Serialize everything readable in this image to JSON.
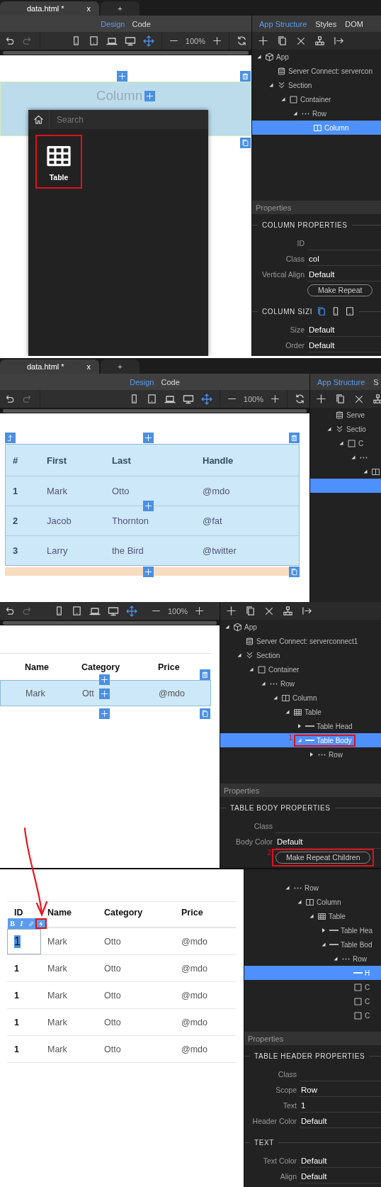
{
  "panels": [
    {
      "kind": "insert",
      "tabs": [
        {
          "label": "data.html *",
          "close": "x",
          "selected": true
        },
        {
          "label": "+",
          "selected": false
        }
      ],
      "modes": [
        {
          "label": "Design",
          "selected": true
        },
        {
          "label": "Code",
          "selected": false
        }
      ],
      "zoom": "100%",
      "canvas": {
        "block_label": "Column",
        "popup": {
          "placeholder": "Search",
          "items": [
            {
              "label": "Table",
              "highlighted": true
            }
          ]
        }
      },
      "side": {
        "tabs": [
          {
            "label": "App Structure",
            "selected": true
          },
          {
            "label": "Styles",
            "selected": false
          },
          {
            "label": "DOM",
            "selected": false
          }
        ],
        "tree": [
          {
            "kind": "app",
            "label": "App",
            "expanded": true,
            "selected": false,
            "children": [
              {
                "kind": "server",
                "label": "Server Connect: servercon",
                "selected": false
              },
              {
                "kind": "section",
                "label": "Section",
                "expanded": true,
                "selected": false,
                "children": [
                  {
                    "kind": "container",
                    "label": "Container",
                    "expanded": true,
                    "selected": false,
                    "children": [
                      {
                        "kind": "row",
                        "label": "Row",
                        "expanded": true,
                        "selected": false,
                        "children": [
                          {
                            "kind": "column",
                            "label": "Column",
                            "selected": true
                          }
                        ]
                      }
                    ]
                  }
                ]
              }
            ]
          }
        ],
        "properties": {
          "header": "Properties",
          "sections": [
            {
              "title": "COLUMN PROPERTIES",
              "fields": [
                {
                  "kind": "field",
                  "label": "ID"
                },
                {
                  "kind": "field",
                  "label": "Class",
                  "value": "col"
                },
                {
                  "kind": "field",
                  "label": "Vertical Align",
                  "value": "Default"
                },
                {
                  "kind": "button",
                  "label": "Make Repeat"
                }
              ]
            },
            {
              "title": "COLUMN SIZI",
              "devices": [
                {
                  "selected": true
                },
                {
                  "selected": false
                },
                {
                  "selected": false
                }
              ],
              "fields": [
                {
                  "kind": "field",
                  "label": "Size",
                  "value": "Default"
                },
                {
                  "kind": "field",
                  "label": "Order",
                  "value": "Default"
                }
              ]
            }
          ]
        }
      }
    },
    {
      "kind": "table",
      "tabs": [
        {
          "label": "data.html *",
          "close": "x",
          "selected": true
        },
        {
          "label": "+",
          "selected": false
        }
      ],
      "modes": [
        {
          "label": "Design",
          "selected": true
        },
        {
          "label": "Code",
          "selected": false
        }
      ],
      "zoom": "100%",
      "canvas": {
        "table": {
          "columns": [
            "#",
            "First",
            "Last",
            "Handle"
          ],
          "rows": [
            {
              "cells": [
                "1",
                "Mark",
                "Otto",
                "@mdo"
              ]
            },
            {
              "cells": [
                "2",
                "Jacob",
                "Thornton",
                "@fat"
              ]
            },
            {
              "cells": [
                "3",
                "Larry",
                "the Bird",
                "@twitter"
              ]
            }
          ]
        }
      },
      "side": {
        "tabs": [
          {
            "label": "App Structure",
            "selected": true
          },
          {
            "label": "S",
            "selected": false
          }
        ],
        "tree": [
          {
            "kind": "server",
            "label": "Serve",
            "selected": false
          },
          {
            "kind": "section",
            "label": "Sectio",
            "expanded": true,
            "selected": false,
            "children": [
              {
                "kind": "container",
                "label": "C",
                "expanded": true,
                "selected": false,
                "children": [
                  {
                    "kind": "row",
                    "expanded": true,
                    "selected": false,
                    "children": [
                      {
                        "kind": "column",
                        "expanded": true,
                        "selected": false,
                        "children": [
                          {
                            "kind": "table",
                            "selected": true
                          }
                        ]
                      }
                    ]
                  }
                ]
              }
            ]
          }
        ]
      }
    },
    {
      "kind": "repeat",
      "zoom": "100%",
      "canvas": {
        "table": {
          "columns": [
            "Name",
            "Category",
            "Price"
          ],
          "rows": [
            {
              "cells": [
                "Mark",
                "Ott",
                "@mdo"
              ]
            }
          ]
        }
      },
      "side": {
        "tree": [
          {
            "kind": "app",
            "label": "App",
            "expanded": true,
            "selected": false,
            "children": [
              {
                "kind": "server",
                "label": "Server Connect: serverconnect1",
                "selected": false
              },
              {
                "kind": "section",
                "label": "Section",
                "expanded": true,
                "selected": false,
                "children": [
                  {
                    "kind": "container",
                    "label": "Container",
                    "expanded": true,
                    "selected": false,
                    "children": [
                      {
                        "kind": "row",
                        "label": "Row",
                        "expanded": true,
                        "selected": false,
                        "children": [
                          {
                            "kind": "column",
                            "label": "Column",
                            "expanded": true,
                            "selected": false,
                            "children": [
                              {
                                "kind": "table",
                                "label": "Table",
                                "expanded": true,
                                "selected": false,
                                "children": [
                                  {
                                    "kind": "part",
                                    "label": "Table Head",
                                    "expanded": false,
                                    "selected": false
                                  },
                                  {
                                    "kind": "part",
                                    "label": "Table Body",
                                    "expanded": true,
                                    "selected": true,
                                    "highlighted": true,
                                    "marker": "1",
                                    "children": [
                                      {
                                        "kind": "row",
                                        "label": "Row",
                                        "expanded": false,
                                        "selected": false
                                      }
                                    ]
                                  }
                                ]
                              }
                            ]
                          }
                        ]
                      }
                    ]
                  }
                ]
              }
            ]
          }
        ],
        "properties": {
          "header": "Properties",
          "sections": [
            {
              "title": "TABLE BODY PROPERTIES",
              "fields": [
                {
                  "kind": "field",
                  "label": "Class"
                },
                {
                  "kind": "field",
                  "label": "Body Color",
                  "value": "Default"
                },
                {
                  "kind": "button",
                  "label": "Make Repeat Children",
                  "highlighted": true,
                  "marker": "2"
                }
              ]
            }
          ]
        }
      }
    },
    {
      "kind": "header",
      "canvas": {
        "table": {
          "columns": [
            "ID",
            "Name",
            "Category",
            "Price"
          ],
          "rows": [
            {
              "cells": [
                "1",
                "Mark",
                "Otto",
                "@mdo"
              ],
              "editing": true
            },
            {
              "cells": [
                "1",
                "Mark",
                "Otto",
                "@mdo"
              ],
              "editing": false
            },
            {
              "cells": [
                "1",
                "Mark",
                "Otto",
                "@mdo"
              ],
              "editing": false
            },
            {
              "cells": [
                "1",
                "Mark",
                "Otto",
                "@mdo"
              ],
              "editing": false
            },
            {
              "cells": [
                "1",
                "Mark",
                "Otto",
                "@mdo"
              ],
              "editing": false
            }
          ]
        },
        "format_tools": [
          {
            "kind": "text",
            "label": "B"
          },
          {
            "kind": "text",
            "label": "I"
          },
          {
            "kind": "link"
          },
          {
            "kind": "bolt",
            "highlighted": true
          }
        ]
      },
      "side": {
        "tree": [
          {
            "kind": "row",
            "label": "Row",
            "expanded": true,
            "selected": false,
            "children": [
              {
                "kind": "column",
                "label": "Column",
                "expanded": true,
                "selected": false,
                "children": [
                  {
                    "kind": "table",
                    "label": "Table",
                    "expanded": true,
                    "selected": false,
                    "children": [
                      {
                        "kind": "part",
                        "label": "Table Hea",
                        "expanded": false,
                        "selected": false
                      },
                      {
                        "kind": "part",
                        "label": "Table Bod",
                        "expanded": true,
                        "selected": false,
                        "children": [
                          {
                            "kind": "row",
                            "label": "Row",
                            "expanded": true,
                            "selected": false,
                            "children": [
                              {
                                "kind": "part",
                                "label": "H",
                                "selected": true
                              },
                              {
                                "kind": "cell",
                                "label": "C",
                                "selected": false
                              },
                              {
                                "kind": "cell",
                                "label": "C",
                                "selected": false
                              },
                              {
                                "kind": "cell",
                                "label": "C",
                                "selected": false
                              }
                            ]
                          }
                        ]
                      }
                    ]
                  }
                ]
              }
            ]
          }
        ],
        "properties": {
          "header": "Properties",
          "sections": [
            {
              "title": "TABLE HEADER PROPERTIES",
              "fields": [
                {
                  "kind": "field",
                  "label": "Class"
                },
                {
                  "kind": "field",
                  "label": "Scope",
                  "value": "Row"
                },
                {
                  "kind": "field",
                  "label": "Text",
                  "value": "1"
                },
                {
                  "kind": "field",
                  "label": "Header Color",
                  "value": "Default"
                }
              ]
            },
            {
              "title": "TEXT",
              "fields": [
                {
                  "kind": "field",
                  "label": "Text Color",
                  "value": "Default"
                },
                {
                  "kind": "field",
                  "label": "Align",
                  "value": "Default"
                }
              ]
            }
          ]
        }
      }
    }
  ]
}
